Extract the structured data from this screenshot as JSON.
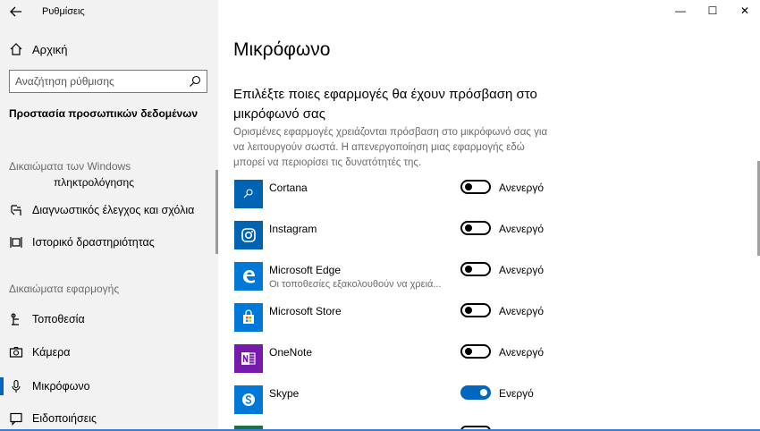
{
  "window": {
    "app_title": "Ρυθμίσεις",
    "minimize": "—",
    "maximize": "☐",
    "close": "✕"
  },
  "sidebar": {
    "home_label": "Αρχική",
    "search_placeholder": "Αναζήτηση ρύθμισης",
    "current_section": "Προστασία προσωπικών δεδομένων",
    "group1_label": "Δικαιώματα των Windows",
    "group1_sub": "πληκτρολόγησης",
    "items_windows": [
      {
        "label": "Διαγνωστικός έλεγχος και σχόλια",
        "icon": "feedback-icon"
      },
      {
        "label": "Ιστορικό δραστηριότητας",
        "icon": "timeline-icon"
      }
    ],
    "group2_label": "Δικαιώματα εφαρμογής",
    "items_apps": [
      {
        "label": "Τοποθεσία",
        "icon": "location-icon"
      },
      {
        "label": "Κάμερα",
        "icon": "camera-icon"
      },
      {
        "label": "Μικρόφωνο",
        "icon": "microphone-icon",
        "active": true
      },
      {
        "label": "Ειδοποιήσεις",
        "icon": "notifications-icon"
      }
    ]
  },
  "main": {
    "title": "Μικρόφωνο",
    "heading": "Επιλέξτε ποιες εφαρμογές θα έχουν πρόσβαση στο μικρόφωνό σας",
    "description": "Ορισμένες εφαρμογές χρειάζονται πρόσβαση στο μικρόφωνό σας για να λειτουργούν σωστά. Η απενεργοποίηση μιας εφαρμογής εδώ μπορεί να περιορίσει τις δυνατότητές της.",
    "apps": [
      {
        "name": "Cortana",
        "sub": "",
        "state": "Ανενεργό",
        "on": false,
        "tile_color": "#0063b1",
        "icon": "cortana-icon"
      },
      {
        "name": "Instagram",
        "sub": "",
        "state": "Ανενεργό",
        "on": false,
        "tile_color": "#0063b1",
        "icon": "instagram-icon"
      },
      {
        "name": "Microsoft Edge",
        "sub": "Οι τοποθεσίες εξακολουθούν να χρειά...",
        "state": "Ανενεργό",
        "on": false,
        "tile_color": "#0078d7",
        "icon": "edge-icon"
      },
      {
        "name": "Microsoft Store",
        "sub": "",
        "state": "Ανενεργό",
        "on": false,
        "tile_color": "#0078d7",
        "icon": "store-icon"
      },
      {
        "name": "OneNote",
        "sub": "",
        "state": "Ανενεργό",
        "on": false,
        "tile_color": "#7719aa",
        "icon": "onenote-icon"
      },
      {
        "name": "Skype",
        "sub": "",
        "state": "Ενεργό",
        "on": true,
        "tile_color": "#0078d7",
        "icon": "skype-icon"
      }
    ]
  }
}
